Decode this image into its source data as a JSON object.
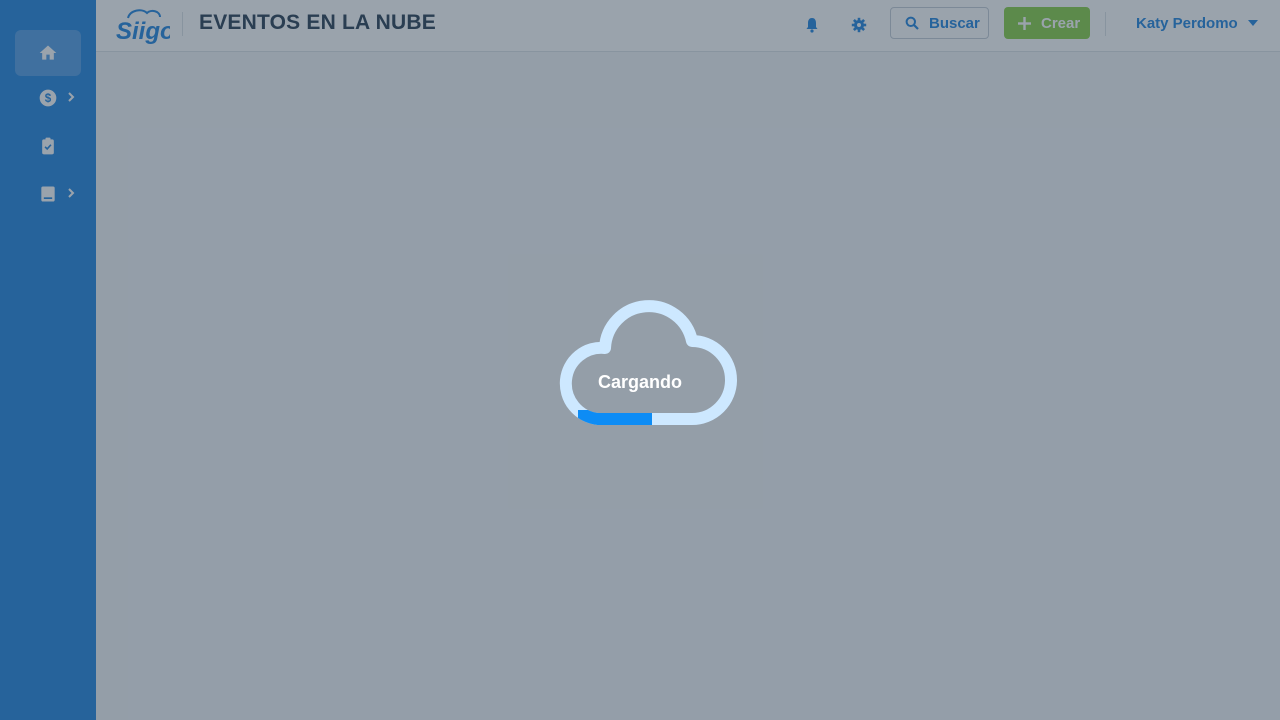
{
  "app": {
    "logo_text": "Siigo",
    "brand_color": "#2d8ae1",
    "accent_green": "#8fd14f"
  },
  "sidebar": {
    "items": [
      {
        "icon": "home-icon",
        "active": true,
        "has_submenu": false
      },
      {
        "icon": "dollar-circle-icon",
        "active": false,
        "has_submenu": true
      },
      {
        "icon": "clipboard-check-icon",
        "active": false,
        "has_submenu": false
      },
      {
        "icon": "book-icon",
        "active": false,
        "has_submenu": true
      }
    ]
  },
  "header": {
    "title": "EVENTOS EN LA NUBE",
    "notifications_icon": "bell-icon",
    "settings_icon": "gear-icon",
    "search_label": "Buscar",
    "create_label": "Crear",
    "user_name": "Katy Perdomo"
  },
  "loader": {
    "label": "Cargando",
    "icon": "cloud-icon",
    "ring_color": "#cde8ff",
    "progress_color": "#0d8cf5"
  }
}
